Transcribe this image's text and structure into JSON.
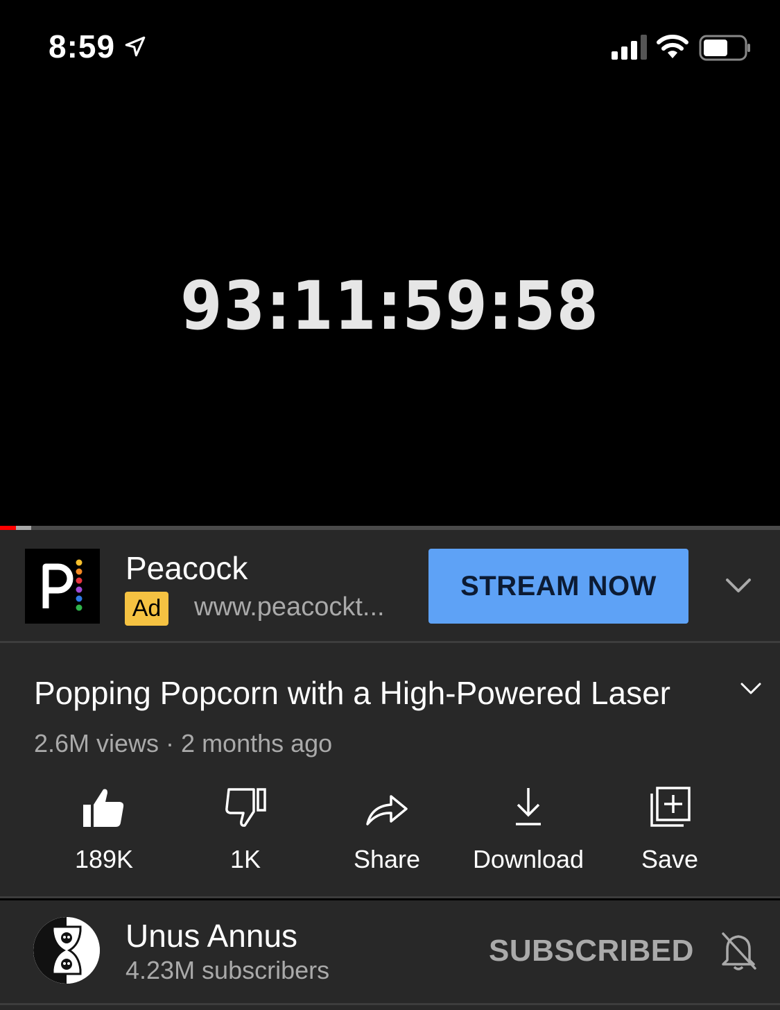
{
  "status_bar": {
    "time": "8:59"
  },
  "player": {
    "countdown": "93:11:59:58",
    "progress_played": 0.02,
    "progress_buffered": 0.04
  },
  "ad": {
    "advertiser": "Peacock",
    "badge": "Ad",
    "url": "www.peacockt...",
    "cta_label": "STREAM NOW",
    "cta_color": "#5ea2f6",
    "badge_color": "#f5c242"
  },
  "video": {
    "title": "Popping Popcorn with a High-Powered Laser",
    "meta": "2.6M views · 2 months ago"
  },
  "actions": [
    {
      "label": "189K",
      "icon": "thumbs-up-icon"
    },
    {
      "label": "1K",
      "icon": "thumbs-down-icon"
    },
    {
      "label": "Share",
      "icon": "share-icon"
    },
    {
      "label": "Download",
      "icon": "download-icon"
    },
    {
      "label": "Save",
      "icon": "save-to-playlist-icon"
    }
  ],
  "channel": {
    "name": "Unus Annus",
    "subscribers": "4.23M subscribers",
    "subscribe_state": "SUBSCRIBED"
  },
  "colors": {
    "panel_bg": "#282828",
    "progress_red": "#ff0000",
    "secondary_text": "#aaaaaa"
  }
}
